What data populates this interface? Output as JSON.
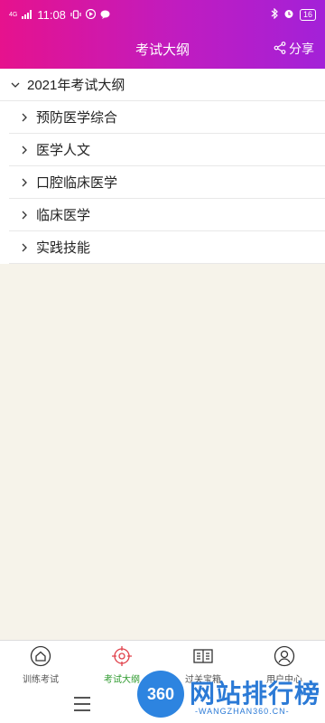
{
  "status_bar": {
    "network": "4G",
    "time": "11:08",
    "battery": "16"
  },
  "header": {
    "title": "考试大纲",
    "share_label": "分享"
  },
  "outline": {
    "root_label": "2021年考试大纲",
    "items": [
      {
        "label": "预防医学综合"
      },
      {
        "label": "医学人文"
      },
      {
        "label": "口腔临床医学"
      },
      {
        "label": "临床医学"
      },
      {
        "label": "实践技能"
      }
    ]
  },
  "tabbar": {
    "active_color": "#2e9a2e",
    "tabs": [
      {
        "label": "训练考试",
        "icon": "home-icon"
      },
      {
        "label": "考试大纲",
        "icon": "target-icon"
      },
      {
        "label": "过关宝箱",
        "icon": "book-icon"
      },
      {
        "label": "用户中心",
        "icon": "user-icon"
      }
    ]
  },
  "watermark": {
    "badge": "360",
    "text": "网站排行榜",
    "url": "-WANGZHAN360.CN-"
  }
}
